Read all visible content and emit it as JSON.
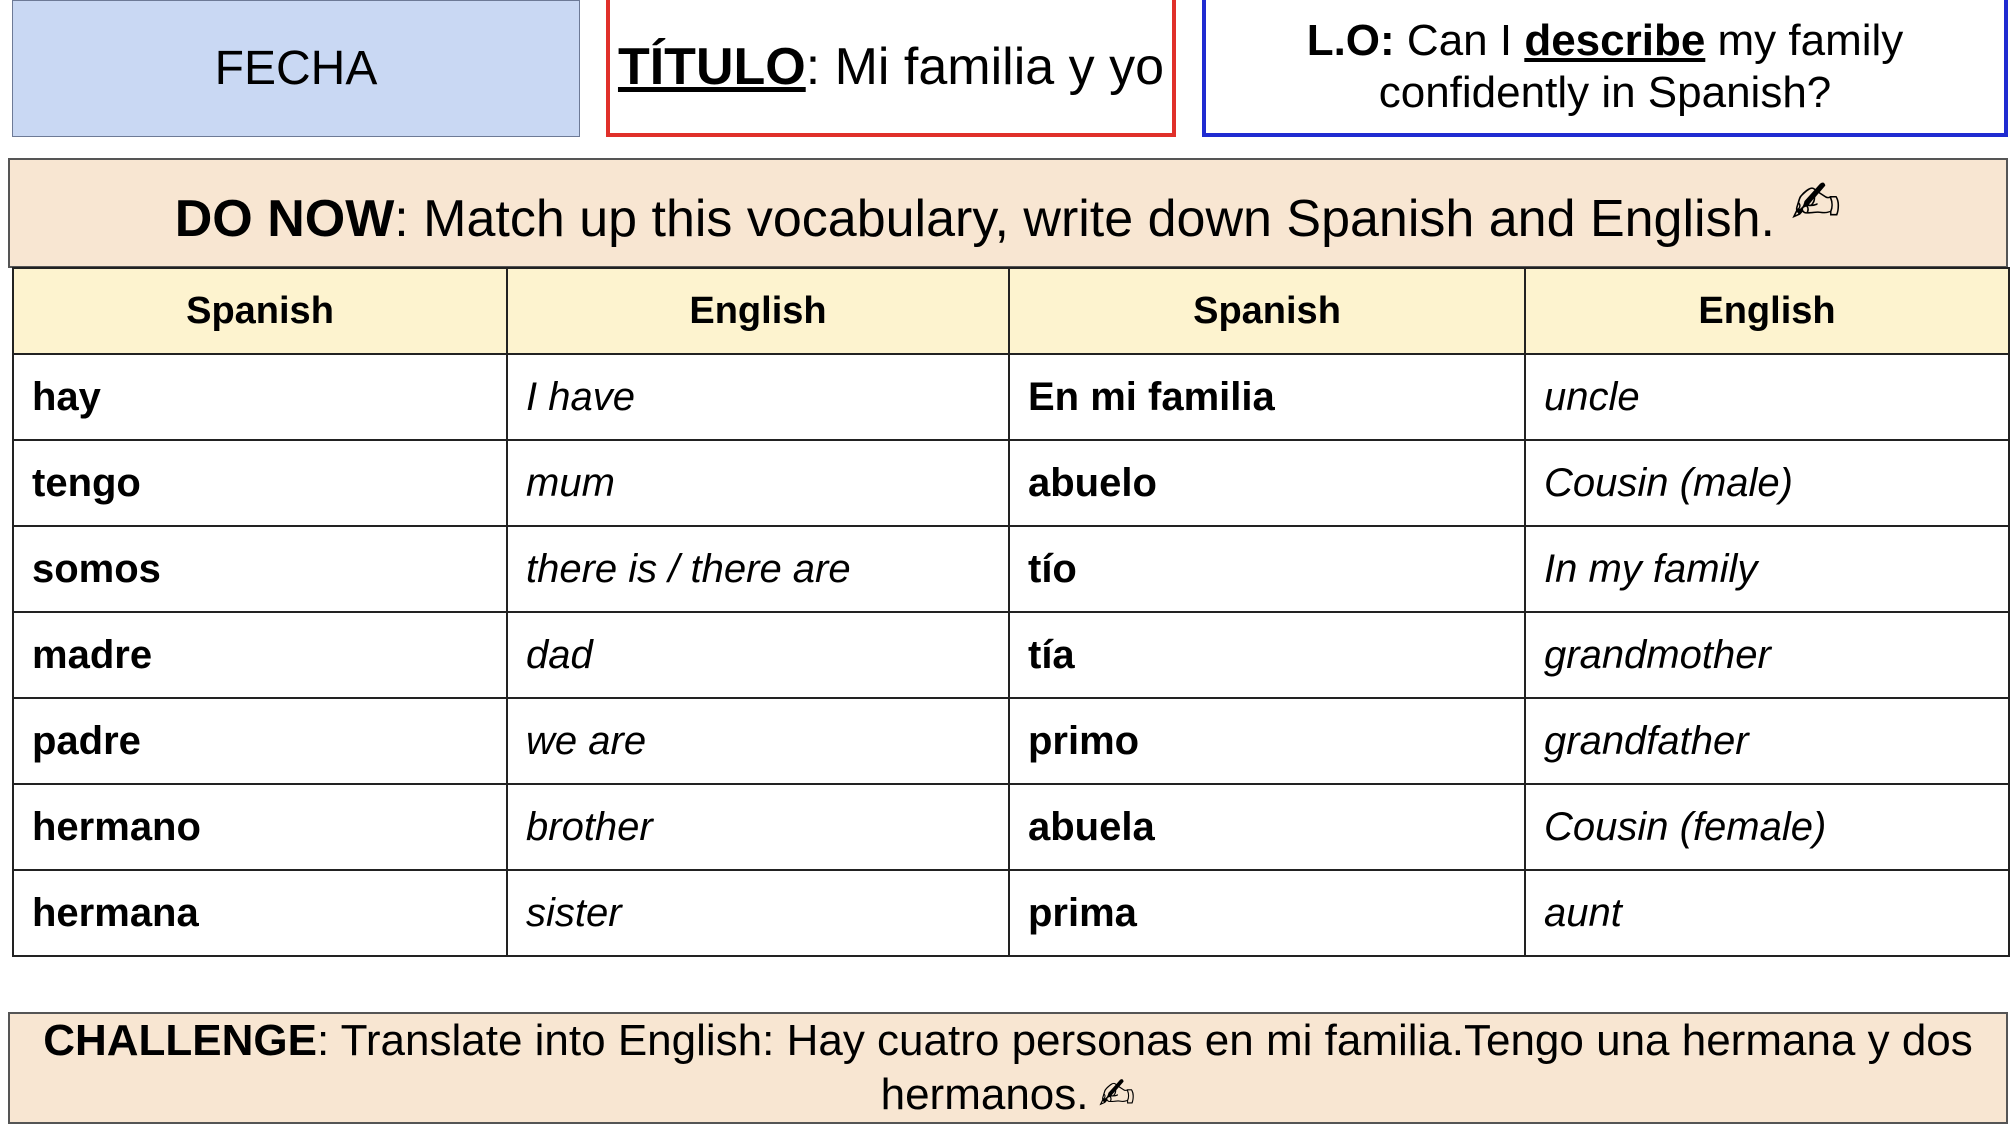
{
  "header": {
    "fecha": "FECHA",
    "titulo_label": "TÍTULO",
    "titulo_text": ": Mi familia y yo",
    "lo_label": "L.O:",
    "lo_text_1": " Can I ",
    "lo_keyword": "describe",
    "lo_text_2": " my family confidently in Spanish?"
  },
  "do_now": {
    "label": "DO NOW",
    "text": ": Match up this vocabulary, write down Spanish and English.",
    "icon": "writing-hand-icon"
  },
  "table": {
    "headers": [
      "Spanish",
      "English",
      "Spanish",
      "English"
    ],
    "rows": [
      [
        "hay",
        "I have",
        "En mi familia",
        "uncle"
      ],
      [
        "tengo",
        "mum",
        "abuelo",
        "Cousin (male)"
      ],
      [
        "somos",
        "there is / there are",
        "tío",
        "In my family"
      ],
      [
        "madre",
        "dad",
        "tía",
        "grandmother"
      ],
      [
        "padre",
        "we are",
        "primo",
        "grandfather"
      ],
      [
        "hermano",
        "brother",
        "abuela",
        "Cousin (female)"
      ],
      [
        "hermana",
        "sister",
        "prima",
        "aunt"
      ]
    ]
  },
  "challenge": {
    "label": "CHALLENGE",
    "text": ": Translate into English: Hay cuatro personas en mi familia.Tengo una hermana y dos hermanos.",
    "icon": "writing-hand-icon"
  }
}
